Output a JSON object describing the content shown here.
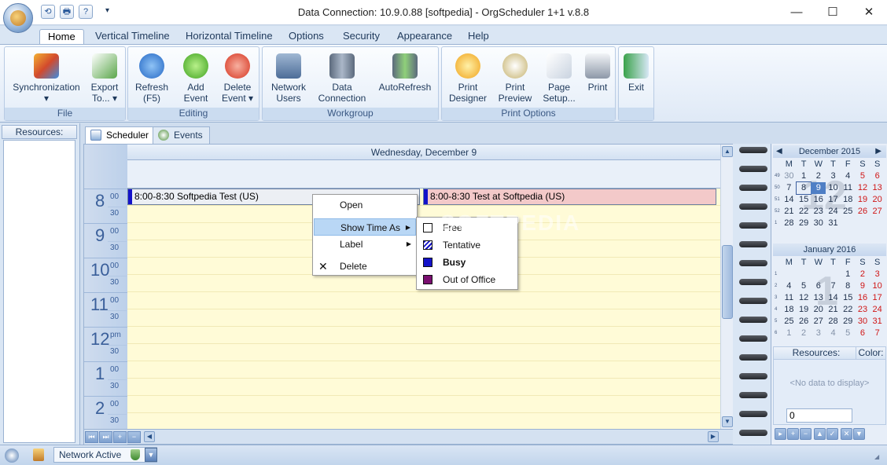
{
  "window": {
    "title": "Data Connection: 10.9.0.88 [softpedia] - OrgScheduler 1+1 v.8.8",
    "minimize": "—",
    "maximize": "☐",
    "close": "✕"
  },
  "qat": {
    "back": "⟲",
    "print": "🖶",
    "help": "?",
    "dropdown": "▾"
  },
  "tabs": [
    "Home",
    "Vertical Timeline",
    "Horizontal Timeline",
    "Options",
    "Security",
    "Appearance",
    "Help"
  ],
  "ribbon": {
    "groups": {
      "file": "File",
      "editing": "Editing",
      "workgroup": "Workgroup",
      "print_options": "Print Options"
    },
    "buttons": {
      "synchronization": "Synchronization\n▾",
      "export": "Export\nTo... ▾",
      "refresh": "Refresh\n(F5)",
      "add_event": "Add\nEvent",
      "delete_event": "Delete\nEvent ▾",
      "network_users": "Network\nUsers",
      "data_connection": "Data\nConnection",
      "autorefresh": "AutoRefresh",
      "print_designer": "Print\nDesigner",
      "print_preview": "Print\nPreview",
      "page_setup": "Page\nSetup...",
      "print": "Print",
      "exit": "Exit"
    }
  },
  "left_panel": {
    "resources_label": "Resources:"
  },
  "view_tabs": {
    "scheduler": "Scheduler",
    "events": "Events"
  },
  "scheduler": {
    "day_header": "Wednesday, December 9",
    "hours": [
      {
        "h": "8",
        "ap": "00",
        "half": "30"
      },
      {
        "h": "9",
        "ap": "00",
        "half": "30"
      },
      {
        "h": "10",
        "ap": "00",
        "half": "30"
      },
      {
        "h": "11",
        "ap": "00",
        "half": "30"
      },
      {
        "h": "12",
        "ap": "pm",
        "half": "30"
      },
      {
        "h": "1",
        "ap": "00",
        "half": "30"
      },
      {
        "h": "2",
        "ap": "00",
        "half": "30"
      }
    ],
    "appointments": [
      {
        "text": "8:00-8:30 Softpedia Test (US)"
      },
      {
        "text": "8:00-8:30 Test at Softpedia (US)"
      }
    ]
  },
  "context_menu": {
    "open": "Open",
    "show_time_as": "Show Time As",
    "label": "Label",
    "delete": "Delete",
    "submenu": {
      "free": "Free",
      "tentative": "Tentative",
      "busy": "Busy",
      "out_of_office": "Out of Office"
    },
    "colors": {
      "free": "#ffffff",
      "busy": "#1412c9",
      "out_of_office": "#7a0f70"
    }
  },
  "watermark": "SOFTPEDIA",
  "calendar": {
    "dow": [
      "M",
      "T",
      "W",
      "T",
      "F",
      "S",
      "S"
    ],
    "dec": {
      "title": "December 2015",
      "bignum": "12",
      "weeks": [
        {
          "wk": "49",
          "days": [
            "30",
            "1",
            "2",
            "3",
            "4",
            "5",
            "6"
          ]
        },
        {
          "wk": "50",
          "days": [
            "7",
            "8",
            "9",
            "10",
            "11",
            "12",
            "13"
          ]
        },
        {
          "wk": "51",
          "days": [
            "14",
            "15",
            "16",
            "17",
            "18",
            "19",
            "20"
          ]
        },
        {
          "wk": "52",
          "days": [
            "21",
            "22",
            "23",
            "24",
            "25",
            "26",
            "27"
          ]
        },
        {
          "wk": "1",
          "days": [
            "28",
            "29",
            "30",
            "31",
            "",
            "",
            ""
          ]
        }
      ]
    },
    "jan": {
      "title": "January 2016",
      "bignum": "1",
      "weeks": [
        {
          "wk": "1",
          "days": [
            "",
            "",
            "",
            "",
            "1",
            "2",
            "3"
          ]
        },
        {
          "wk": "2",
          "days": [
            "4",
            "5",
            "6",
            "7",
            "8",
            "9",
            "10"
          ]
        },
        {
          "wk": "3",
          "days": [
            "11",
            "12",
            "13",
            "14",
            "15",
            "16",
            "17"
          ]
        },
        {
          "wk": "4",
          "days": [
            "18",
            "19",
            "20",
            "21",
            "22",
            "23",
            "24"
          ]
        },
        {
          "wk": "5",
          "days": [
            "25",
            "26",
            "27",
            "28",
            "29",
            "30",
            "31"
          ]
        },
        {
          "wk": "6",
          "days": [
            "1",
            "2",
            "3",
            "4",
            "5",
            "6",
            "7"
          ]
        }
      ]
    }
  },
  "right_resources": {
    "resources": "Resources:",
    "color": "Color:",
    "empty": "<No data to display>",
    "value": "0"
  },
  "status": {
    "network": "Network Active"
  }
}
